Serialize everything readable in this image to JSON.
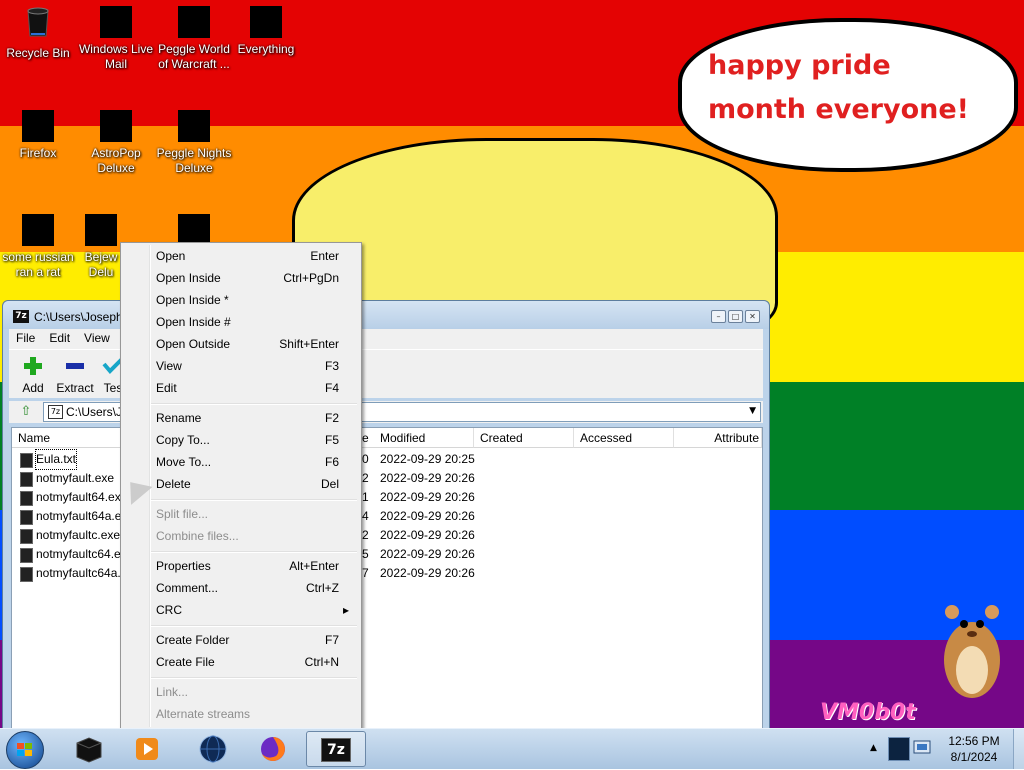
{
  "wallpaper": {
    "speech": "happy pride month everyone!",
    "watermark": "VM0b0t"
  },
  "desktop_icons": [
    {
      "label": "Recycle Bin",
      "icon": "recycle-bin-icon"
    },
    {
      "label": "Windows Live Mail",
      "icon": "windows-live-mail-icon"
    },
    {
      "label": "Peggle World of Warcraft ...",
      "icon": "peggle-wow-icon"
    },
    {
      "label": "Everything",
      "icon": "everything-search-icon"
    },
    {
      "label": "Firefox",
      "icon": "firefox-icon"
    },
    {
      "label": "AstroPop Deluxe",
      "icon": "astropop-icon"
    },
    {
      "label": "Peggle Nights Deluxe",
      "icon": "peggle-nights-icon"
    },
    {
      "label": "some russian ran a rat",
      "icon": "ie-rat-icon"
    },
    {
      "label": "Bejew Delu",
      "icon": "bejeweled-icon"
    },
    {
      "label": "",
      "icon": "game-icon"
    }
  ],
  "window": {
    "title": "C:\\Users\\Joseph",
    "app_icon": "7z",
    "menu": [
      "File",
      "Edit",
      "View"
    ],
    "toolbar": [
      {
        "label": "Add",
        "icon": "add-plus-icon"
      },
      {
        "label": "Extract",
        "icon": "extract-minus-icon"
      },
      {
        "label": "Tes",
        "icon": "test-check-icon"
      }
    ],
    "address": "C:\\Users\\J",
    "columns": [
      "Name",
      "e",
      "Modified",
      "Created",
      "Accessed",
      "Attribute"
    ],
    "files": [
      {
        "name": "Eula.txt",
        "size_tail": "0",
        "modified": "2022-09-29 20:25"
      },
      {
        "name": "notmyfault.exe",
        "size_tail": "2",
        "modified": "2022-09-29 20:26"
      },
      {
        "name": "notmyfault64.ex",
        "size_tail": "1",
        "modified": "2022-09-29 20:26"
      },
      {
        "name": "notmyfault64a.e",
        "size_tail": "4",
        "modified": "2022-09-29 20:26"
      },
      {
        "name": "notmyfaultc.exe",
        "size_tail": "2",
        "modified": "2022-09-29 20:26"
      },
      {
        "name": "notmyfaultc64.e",
        "size_tail": "5",
        "modified": "2022-09-29 20:26"
      },
      {
        "name": "notmyfaultc64a.",
        "size_tail": "7",
        "modified": "2022-09-29 20:26"
      }
    ]
  },
  "context_menu": {
    "items": [
      {
        "label": "Open",
        "shortcut": "Enter",
        "disabled": false
      },
      {
        "label": "Open Inside",
        "shortcut": "Ctrl+PgDn",
        "disabled": false
      },
      {
        "label": "Open Inside *",
        "shortcut": "",
        "disabled": false
      },
      {
        "label": "Open Inside #",
        "shortcut": "",
        "disabled": false
      },
      {
        "label": "Open Outside",
        "shortcut": "Shift+Enter",
        "disabled": false
      },
      {
        "label": "View",
        "shortcut": "F3",
        "disabled": false
      },
      {
        "label": "Edit",
        "shortcut": "F4",
        "disabled": false
      },
      {
        "label": "Rename",
        "shortcut": "F2",
        "disabled": false
      },
      {
        "label": "Copy To...",
        "shortcut": "F5",
        "disabled": false
      },
      {
        "label": "Move To...",
        "shortcut": "F6",
        "disabled": false
      },
      {
        "label": "Delete",
        "shortcut": "Del",
        "disabled": false
      },
      {
        "label": "Split file...",
        "shortcut": "",
        "disabled": true
      },
      {
        "label": "Combine files...",
        "shortcut": "",
        "disabled": true
      },
      {
        "label": "Properties",
        "shortcut": "Alt+Enter",
        "disabled": false
      },
      {
        "label": "Comment...",
        "shortcut": "Ctrl+Z",
        "disabled": false
      },
      {
        "label": "CRC",
        "shortcut": "▸",
        "disabled": false
      },
      {
        "label": "Create Folder",
        "shortcut": "F7",
        "disabled": false
      },
      {
        "label": "Create File",
        "shortcut": "Ctrl+N",
        "disabled": false
      },
      {
        "label": "Link...",
        "shortcut": "",
        "disabled": true
      },
      {
        "label": "Alternate streams",
        "shortcut": "",
        "disabled": true
      }
    ]
  },
  "taskbar": {
    "buttons": [
      {
        "icon": "black-box-app-icon",
        "active": false
      },
      {
        "icon": "media-player-icon",
        "active": false
      },
      {
        "icon": "globe-app-icon",
        "active": false
      },
      {
        "icon": "firefox-icon",
        "active": false
      },
      {
        "icon": "7zip-icon",
        "label": "7z",
        "active": true
      }
    ],
    "time": "12:56 PM",
    "date": "8/1/2024"
  }
}
